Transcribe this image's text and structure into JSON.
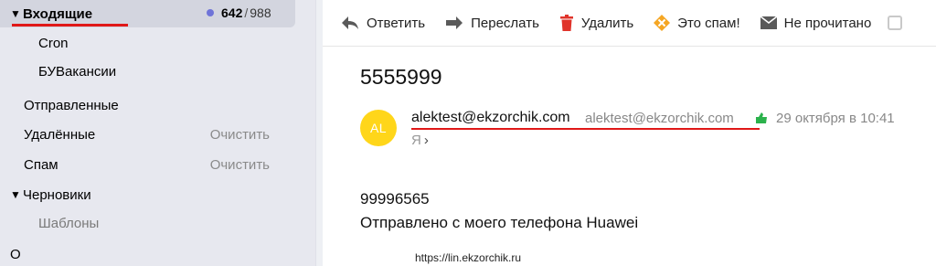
{
  "sidebar": {
    "inbox": {
      "label": "Входящие",
      "unread": "642",
      "separator": "/",
      "total": "988"
    },
    "folders": [
      {
        "label": "Cron"
      },
      {
        "label": "БУВакансии"
      },
      {
        "label": "Отправленные"
      },
      {
        "label": "Удалённые",
        "action": "Очистить"
      },
      {
        "label": "Спам",
        "action": "Очистить"
      },
      {
        "label": "Черновики"
      },
      {
        "label": "Шаблоны"
      }
    ],
    "partial_label": "О"
  },
  "toolbar": {
    "reply": "Ответить",
    "forward": "Переслать",
    "delete": "Удалить",
    "spam": "Это спам!",
    "unread": "Не прочитано"
  },
  "message": {
    "subject": "5555999",
    "avatar_initials": "AL",
    "sender_name": "alektest@ekzorchik.com",
    "sender_email": "alektest@ekzorchik.com",
    "date": "29 октября в 10:41",
    "to": "Я",
    "to_chevron": "›",
    "body": [
      "99996565",
      "Отправлено с моего телефона Huawei"
    ]
  },
  "watermark": "https://lin.ekzorchik.ru",
  "colors": {
    "sidebar_bg": "#e7e8ef",
    "active_folder_bg": "#d3d5df",
    "unread_dot": "#6f74d8",
    "annotation_underline": "#e01818",
    "avatar_bg": "#ffd61a",
    "delete_icon": "#e0342b",
    "spam_icon": "#f5a623",
    "verified_icon": "#2bb24c"
  }
}
